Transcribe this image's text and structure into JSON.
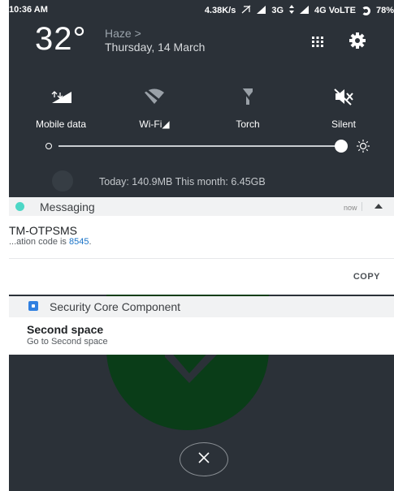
{
  "status_bar": {
    "time": "10:36 AM",
    "speed": "4.38K/s",
    "net_3g": "3G",
    "net_4g": "4G VoLTE",
    "battery": "78%"
  },
  "weather": {
    "temperature": "32°",
    "condition": "Haze >",
    "date": "Thursday, 14 March"
  },
  "quick_settings": [
    {
      "label": "Mobile data",
      "icon": "mobile-data-icon"
    },
    {
      "label": "Wi-Fi◢",
      "icon": "wifi-off-icon"
    },
    {
      "label": "Torch",
      "icon": "torch-off-icon"
    },
    {
      "label": "Silent",
      "icon": "silent-icon"
    }
  ],
  "brightness": {
    "level": 0.96
  },
  "data_usage": {
    "text": "Today: 140.9MB   This month: 6.45GB"
  },
  "notifications": {
    "messaging": {
      "app_name": "Messaging",
      "time": "now",
      "sender": "TM-OTPSMS",
      "body_prefix": "...ation code is ",
      "code": "8545",
      "body_suffix": ".",
      "action": "COPY",
      "accent": "#4dd7c6"
    },
    "security": {
      "app_name": "Security Core Component",
      "title": "Second space",
      "body": "Go to Second space",
      "accent": "#2f7fe0"
    }
  },
  "colors": {
    "shade_bg": "#2b3138",
    "background_art": "#0a3d18",
    "link": "#1a73c7"
  }
}
